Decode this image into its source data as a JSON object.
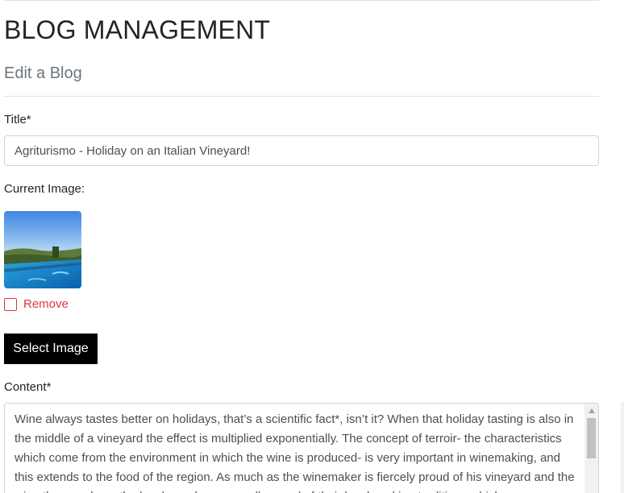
{
  "page": {
    "title": "BLOG MANAGEMENT",
    "subtitle": "Edit a Blog"
  },
  "form": {
    "title_label": "Title*",
    "title_value": "Agriturismo - Holiday on an Italian Vineyard!",
    "current_image_label": "Current Image:",
    "remove_label": "Remove",
    "remove_checked": false,
    "select_image_label": "Select Image",
    "content_label": "Content*",
    "content_value": "Wine always tastes better on holidays, that’s a scientific fact*, isn’t it? When that holiday tasting is also in the middle of a vineyard the effect is multiplied exponentially. The concept of terroir- the characteristics which come from the environment in which the wine is produced- is very important in winemaking, and this extends to the food of the region. As much as the winemaker is fiercely proud of his vineyard and the wine they produce, the local people are equally proud of their local cooking traditions which"
  },
  "icons": {
    "scroll_up": "triangle-up-icon",
    "current_image": "vineyard-pool-photo"
  },
  "colors": {
    "danger": "#dc3545",
    "button_bg": "#000000",
    "muted": "#6c757d"
  }
}
